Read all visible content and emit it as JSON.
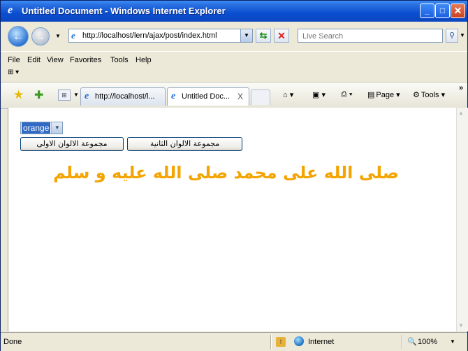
{
  "window": {
    "title": "Untitled Document - Windows Internet Explorer",
    "min_glyph": "_",
    "max_glyph": "□",
    "close_glyph": "✕"
  },
  "address_bar": {
    "url": "http://localhost/lern/ajax/post/index.html"
  },
  "search": {
    "placeholder": "Live Search"
  },
  "menu": {
    "items": [
      "File",
      "Edit",
      "View",
      "Favorites",
      "Tools",
      "Help"
    ]
  },
  "tabs": [
    {
      "label": "http://localhost/l..."
    },
    {
      "label": "Untitled Doc...",
      "close": "X"
    }
  ],
  "command_bar": {
    "page_label": "Page",
    "tools_label": "Tools",
    "overflow": "»"
  },
  "page": {
    "select_value": "orange",
    "button_first": "مجموعة الالوان الاولى",
    "button_second": "مجموعة الالوان الثانية",
    "arabic_heading": "صلى الله على محمد صلى الله عليه و سلم",
    "heading_color": "#f4a400"
  },
  "status_bar": {
    "status": "Done",
    "zone": "Internet",
    "zoom": "100%"
  }
}
